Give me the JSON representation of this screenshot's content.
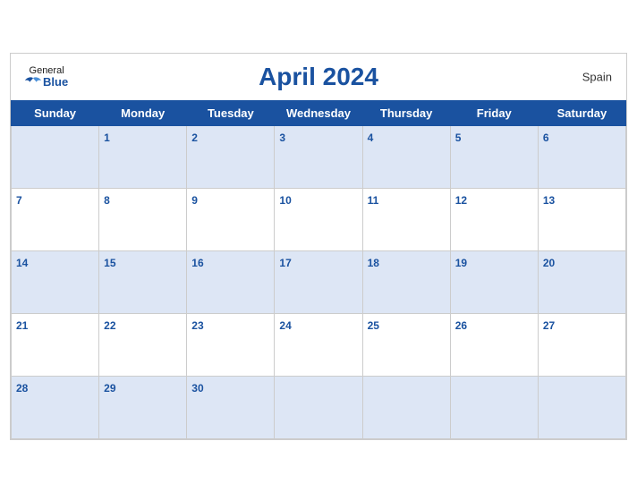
{
  "header": {
    "title": "April 2024",
    "country": "Spain",
    "logo_general": "General",
    "logo_blue": "Blue"
  },
  "days_of_week": [
    "Sunday",
    "Monday",
    "Tuesday",
    "Wednesday",
    "Thursday",
    "Friday",
    "Saturday"
  ],
  "weeks": [
    [
      {
        "day": "",
        "shade": true
      },
      {
        "day": "1",
        "shade": true
      },
      {
        "day": "2",
        "shade": true
      },
      {
        "day": "3",
        "shade": true
      },
      {
        "day": "4",
        "shade": true
      },
      {
        "day": "5",
        "shade": true
      },
      {
        "day": "6",
        "shade": true
      }
    ],
    [
      {
        "day": "7",
        "shade": false
      },
      {
        "day": "8",
        "shade": false
      },
      {
        "day": "9",
        "shade": false
      },
      {
        "day": "10",
        "shade": false
      },
      {
        "day": "11",
        "shade": false
      },
      {
        "day": "12",
        "shade": false
      },
      {
        "day": "13",
        "shade": false
      }
    ],
    [
      {
        "day": "14",
        "shade": true
      },
      {
        "day": "15",
        "shade": true
      },
      {
        "day": "16",
        "shade": true
      },
      {
        "day": "17",
        "shade": true
      },
      {
        "day": "18",
        "shade": true
      },
      {
        "day": "19",
        "shade": true
      },
      {
        "day": "20",
        "shade": true
      }
    ],
    [
      {
        "day": "21",
        "shade": false
      },
      {
        "day": "22",
        "shade": false
      },
      {
        "day": "23",
        "shade": false
      },
      {
        "day": "24",
        "shade": false
      },
      {
        "day": "25",
        "shade": false
      },
      {
        "day": "26",
        "shade": false
      },
      {
        "day": "27",
        "shade": false
      }
    ],
    [
      {
        "day": "28",
        "shade": true
      },
      {
        "day": "29",
        "shade": true
      },
      {
        "day": "30",
        "shade": true
      },
      {
        "day": "",
        "shade": true
      },
      {
        "day": "",
        "shade": true
      },
      {
        "day": "",
        "shade": true
      },
      {
        "day": "",
        "shade": true
      }
    ]
  ]
}
